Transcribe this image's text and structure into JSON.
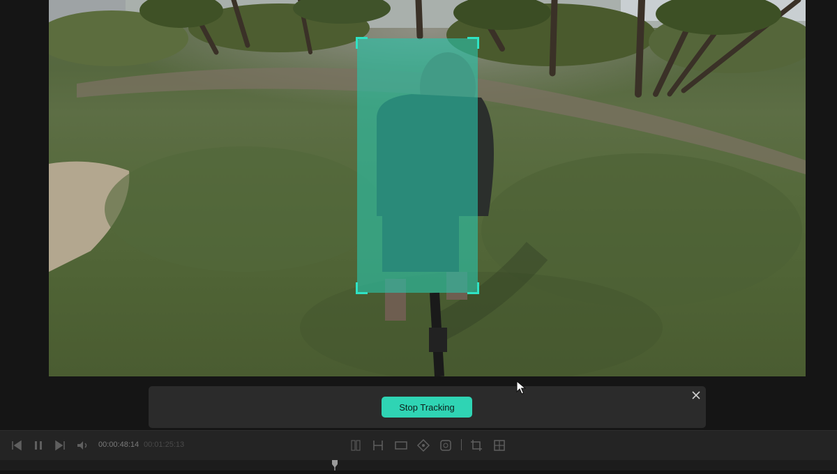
{
  "tracking_panel": {
    "stop_label": "Stop Tracking",
    "close_icon": "close-icon"
  },
  "toolbar": {
    "current_time": "00:00:48:14",
    "total_time": "00:01:25:13",
    "icons": [
      "previous-frame-icon",
      "pause-icon",
      "next-frame-icon",
      "volume-icon",
      "split-icon",
      "trim-icon",
      "aspect-ratio-icon",
      "keyframe-icon",
      "target-icon",
      "crop-icon",
      "grid-icon"
    ]
  },
  "colors": {
    "accent": "#2fd4b4",
    "tracking_overlay": "#2ac4aa",
    "panel_bg": "#2b2b2b",
    "app_bg": "#151515"
  }
}
